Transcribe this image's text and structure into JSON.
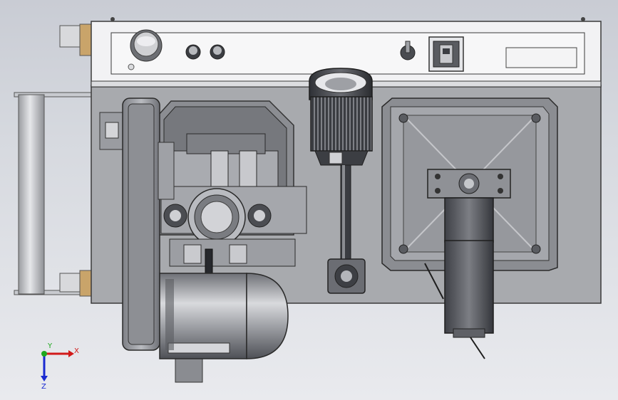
{
  "viewport": {
    "background_top": "#c9ccd4",
    "background_bottom": "#e9eaee"
  },
  "triad": {
    "x_label": "X",
    "y_label": "Y",
    "z_label": "Z",
    "x_color": "#d11a1a",
    "y_color": "#1fa81f",
    "z_color": "#1a2ad1"
  },
  "model": {
    "components": [
      "control-panel",
      "main-plate",
      "drive-belt-guard",
      "pump-housing",
      "electric-motor",
      "work-lamp",
      "gooseneck-arm",
      "lamp-base",
      "mounting-plate",
      "gear-motor",
      "side-roller-frame"
    ],
    "panel_controls": [
      "emergency-stop-button",
      "indicator-light",
      "button-1",
      "button-2",
      "key-switch",
      "power-switch",
      "display-label-window"
    ]
  }
}
